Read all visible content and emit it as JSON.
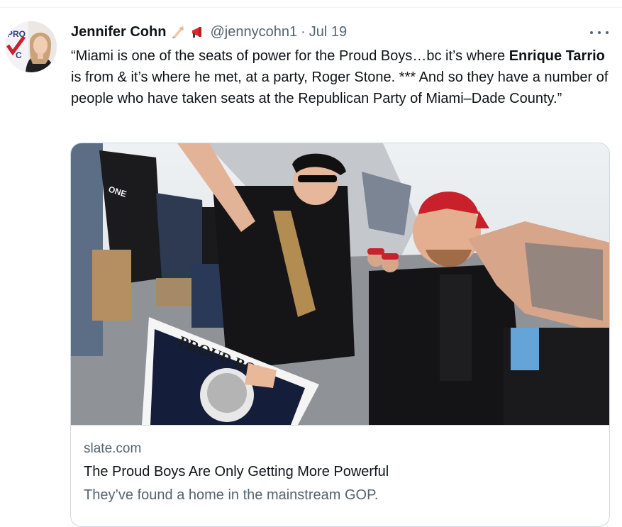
{
  "tweet": {
    "author_name": "Jennifer Cohn",
    "author_emojis": [
      "writing-hand-icon",
      "megaphone-icon"
    ],
    "handle": "@jennycohn1",
    "separator": "·",
    "date": "Jul 19",
    "text": {
      "part1": "“Miami is one of the seats of power for the Proud Boys…bc it’s where ",
      "bold": "Enrique Tarrio",
      "part2": " is from & it’s where he met, at a party, Roger Stone. *** And so they have a number of people who have taken seats at the Republican Party of Miami–Dade County.”"
    }
  },
  "card": {
    "domain": "slate.com",
    "title": "The Proud Boys Are Only Getting More Powerful",
    "description": "They’ve found a home in the mainstream GOP.",
    "image_sign_text": "PROUD BOY",
    "image_shirt_text": "ONE"
  },
  "colors": {
    "text_primary": "#0f1419",
    "text_secondary": "#536471",
    "border": "#cfd9de"
  }
}
